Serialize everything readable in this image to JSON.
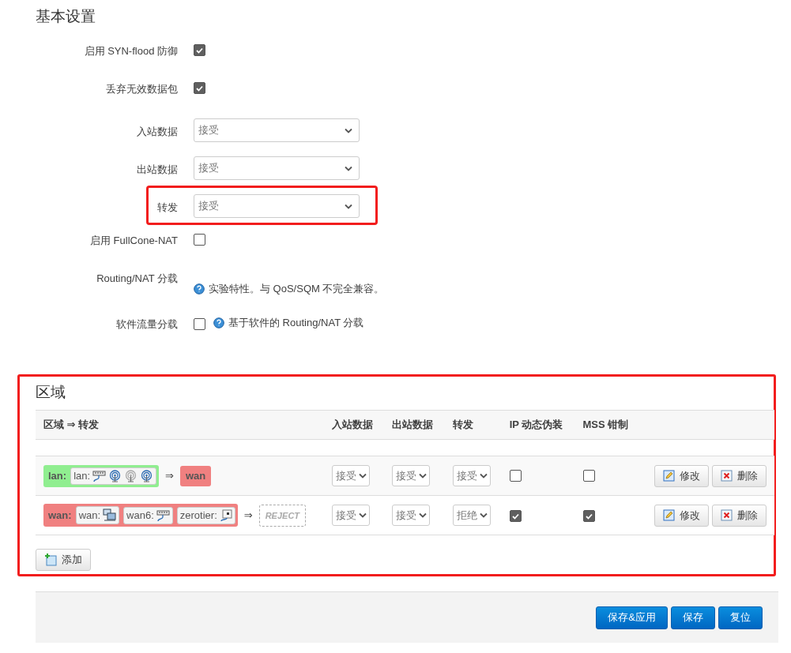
{
  "basic_settings": {
    "title": "基本设置",
    "fields": [
      {
        "kind": "checkbox",
        "label": "启用 SYN-flood 防御",
        "checked": true
      },
      {
        "kind": "checkbox",
        "label": "丢弃无效数据包",
        "checked": true
      },
      {
        "kind": "select",
        "label": "入站数据",
        "value": "接受",
        "highlighted": false
      },
      {
        "kind": "select",
        "label": "出站数据",
        "value": "接受",
        "highlighted": false
      },
      {
        "kind": "select",
        "label": "转发",
        "value": "接受",
        "highlighted": true
      },
      {
        "kind": "checkbox",
        "label": "启用 FullCone-NAT",
        "checked": false
      },
      {
        "kind": "note",
        "label": "Routing/NAT 分载",
        "description": "实验特性。与 QoS/SQM 不完全兼容。"
      },
      {
        "kind": "checkbox",
        "label": "软件流量分载",
        "checked": false,
        "description": "基于软件的 Routing/NAT 分载"
      }
    ]
  },
  "zones": {
    "title": "区域",
    "highlighted": true,
    "columns": [
      "区域 ⇒ 转发",
      "入站数据",
      "出站数据",
      "转发",
      "IP 动态伪装",
      "MSS 钳制"
    ],
    "rows": [
      {
        "zone": {
          "name": "lan:",
          "color": "#90ee90"
        },
        "networks": [
          {
            "name": "lan:",
            "devices": [
              {
                "kind": "ethernet",
                "disabled": false
              },
              {
                "kind": "wireless",
                "disabled": false
              },
              {
                "kind": "wireless",
                "disabled": true
              },
              {
                "kind": "wireless",
                "disabled": false
              }
            ]
          }
        ],
        "arrow": "⇒",
        "destination": {
          "kind": "zone",
          "name": "wan",
          "color": "#f08080"
        },
        "input": "接受",
        "output": "接受",
        "forward": "接受",
        "masquerade": false,
        "mss_clamping": false,
        "edit": "修改",
        "delete": "删除"
      },
      {
        "zone": {
          "name": "wan:",
          "color": "#f08080"
        },
        "networks": [
          {
            "name": "wan:",
            "devices": [
              {
                "kind": "adapter",
                "disabled": false
              }
            ]
          },
          {
            "name": "wan6:",
            "devices": [
              {
                "kind": "ethernet",
                "disabled": false
              }
            ]
          },
          {
            "name": "zerotier:",
            "devices": [
              {
                "kind": "tunnel",
                "disabled": false
              }
            ]
          }
        ],
        "arrow": "⇒",
        "destination": {
          "kind": "reject",
          "name": "REJECT"
        },
        "input": "接受",
        "output": "接受",
        "forward": "拒绝",
        "masquerade": true,
        "mss_clamping": true,
        "edit": "修改",
        "delete": "删除"
      }
    ],
    "add_button": "添加"
  },
  "actions": [
    "保存&应用",
    "保存",
    "复位"
  ]
}
